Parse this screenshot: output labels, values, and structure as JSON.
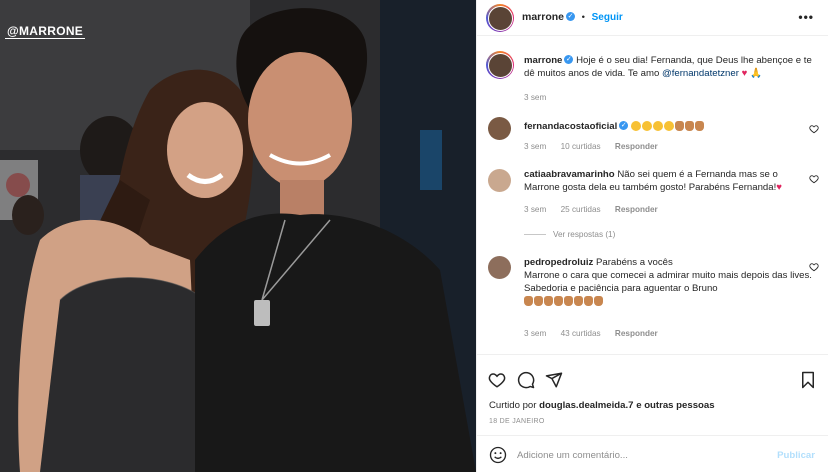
{
  "photo": {
    "watermark": "@MARRONE",
    "alt": "photo"
  },
  "header": {
    "username": "marrone",
    "separator": "•",
    "follow_label": "Seguir",
    "more_label": "•••"
  },
  "caption": {
    "username": "marrone",
    "text": "Hoje é o seu dia! Fernanda, que Deus lhe abençoe e te dê muitos anos de vida. Te amo ",
    "mention": "@fernandatetzner",
    "time": "3 sem"
  },
  "comments": [
    {
      "username": "fernandacostaoficial",
      "verified": true,
      "text": "",
      "time": "3 sem",
      "likes": "10 curtidas",
      "reply": "Responder"
    },
    {
      "username": "catiaabravamarinho",
      "verified": false,
      "text": "Não sei quem é a Fernanda mas se o Marrone gosta dela eu também gosto! Parabéns Fernanda!",
      "time": "3 sem",
      "likes": "25 curtidas",
      "reply": "Responder",
      "view_replies": "Ver respostas (1)"
    },
    {
      "username": "pedropedroluiz",
      "verified": false,
      "line1": "Parabéns a vocês",
      "line2": "Marrone o cara que comecei a admirar muito mais depois das lives.",
      "line3": "Sabedoria e paciência para aguentar o Bruno",
      "time": "3 sem",
      "likes": "43 curtidas",
      "reply": "Responder"
    }
  ],
  "actions": {
    "liked_by_prefix": "Curtido por",
    "liked_by_user": "douglas.dealmeida.7",
    "liked_by_suffix": "e outras pessoas",
    "date": "18 DE JANEIRO",
    "comment_placeholder": "Adicione um comentário...",
    "publish_label": "Publicar"
  },
  "colors": {
    "link": "#0095f6",
    "verified": "#3897f0",
    "heart": "#e0245e",
    "muted": "#8e8e8e"
  },
  "icons": {
    "like": "heart-icon",
    "comment": "comment-icon",
    "share": "paper-plane-icon",
    "save": "bookmark-icon",
    "emoji": "smiley-icon"
  }
}
